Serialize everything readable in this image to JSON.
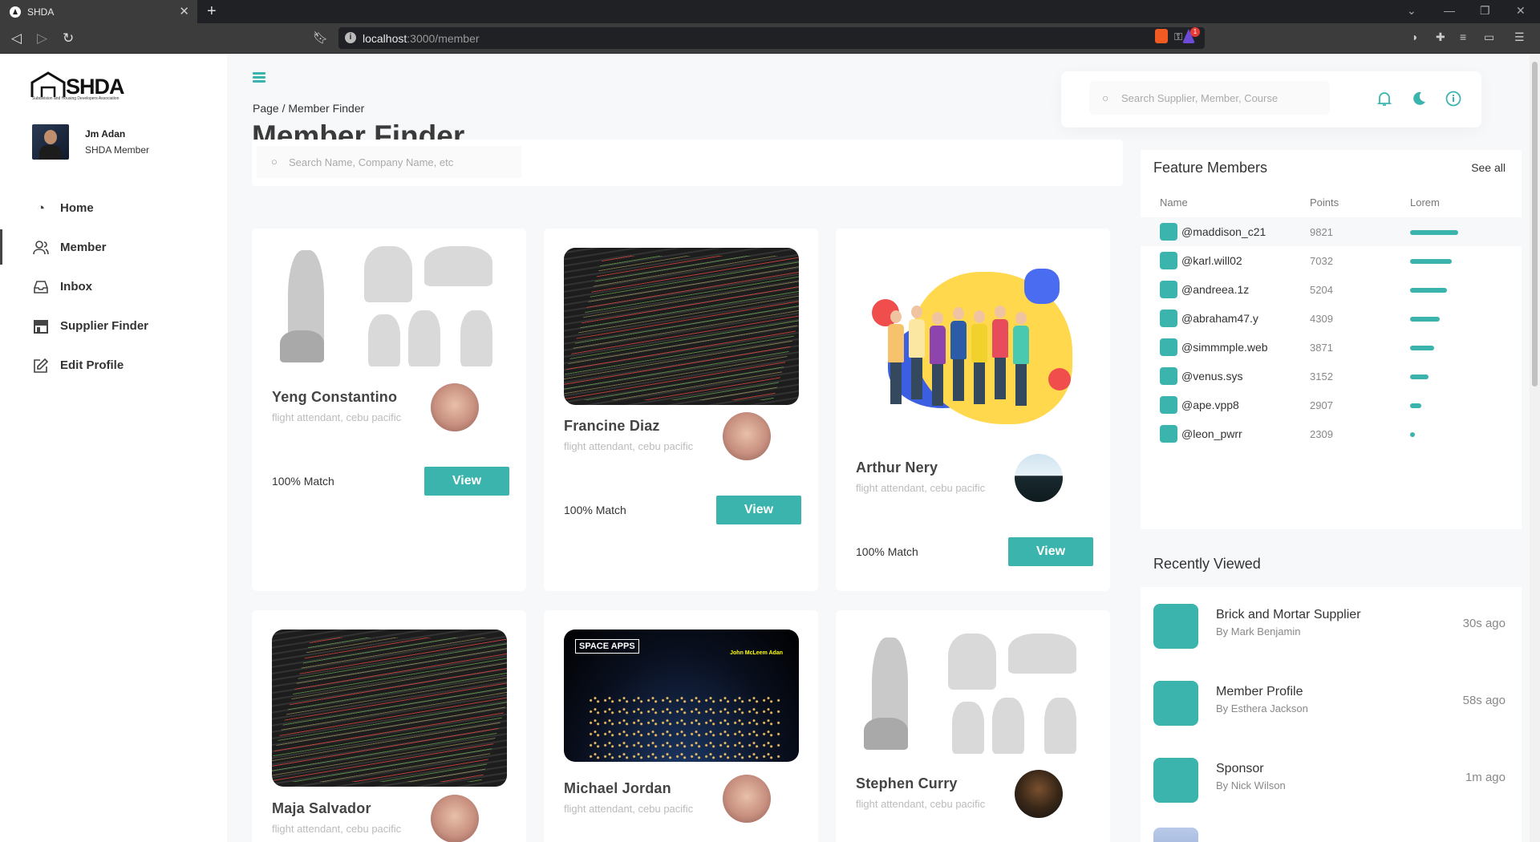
{
  "browser": {
    "tab_title": "SHDA",
    "url_host": "localhost",
    "url_path": ":3000/member",
    "notif_count": "1"
  },
  "brand": {
    "name": "SHDA",
    "tagline": "Subdivision and Housing Developers Association"
  },
  "user": {
    "name": "Jm Adan",
    "role": "SHDA Member"
  },
  "sidebar": {
    "items": [
      {
        "label": "Home",
        "icon": "gauge-icon"
      },
      {
        "label": "Member",
        "icon": "users-icon"
      },
      {
        "label": "Inbox",
        "icon": "inbox-icon"
      },
      {
        "label": "Supplier Finder",
        "icon": "store-icon"
      },
      {
        "label": "Edit Profile",
        "icon": "edit-icon"
      }
    ]
  },
  "header": {
    "breadcrumb": "Page / Member Finder",
    "title": "Member Finder",
    "search_placeholder": "Search Supplier, Member, Course"
  },
  "member_search": {
    "placeholder": "Search Name, Company Name, etc"
  },
  "cards": [
    {
      "name": "Yeng Constantino",
      "subtitle": "flight attendant, cebu pacific",
      "match": "100% Match",
      "button": "View",
      "image": "workout-illustration"
    },
    {
      "name": "Francine Diaz",
      "subtitle": "flight attendant, cebu pacific",
      "match": "100% Match",
      "button": "View",
      "image": "code-screen"
    },
    {
      "name": "Arthur Nery",
      "subtitle": "flight attendant, cebu pacific",
      "match": "100% Match",
      "button": "View",
      "image": "people-illustration"
    },
    {
      "name": "Maja Salvador",
      "subtitle": "flight attendant, cebu pacific",
      "image": "code-screen"
    },
    {
      "name": "Michael Jordan",
      "subtitle": "flight attendant, cebu pacific",
      "image": "space-apps",
      "image_text": "SPACE APPS",
      "image_person": "John McLeem Adan"
    },
    {
      "name": "Stephen Curry",
      "subtitle": "flight attendant, cebu pacific",
      "image": "workout-illustration"
    }
  ],
  "featured": {
    "title": "Feature Members",
    "see_all": "See all",
    "columns": [
      "Name",
      "Points",
      "Lorem"
    ],
    "rows": [
      {
        "handle": "@maddison_c21",
        "points": "9821",
        "level": 1.0
      },
      {
        "handle": "@karl.will02",
        "points": "7032",
        "level": 0.86
      },
      {
        "handle": "@andreea.1z",
        "points": "5204",
        "level": 0.76
      },
      {
        "handle": "@abraham47.y",
        "points": "4309",
        "level": 0.62
      },
      {
        "handle": "@simmmple.web",
        "points": "3871",
        "level": 0.5
      },
      {
        "handle": "@venus.sys",
        "points": "3152",
        "level": 0.38
      },
      {
        "handle": "@ape.vpp8",
        "points": "2907",
        "level": 0.24
      },
      {
        "handle": "@leon_pwrr",
        "points": "2309",
        "level": 0.1
      }
    ]
  },
  "recent": {
    "title": "Recently Viewed",
    "items": [
      {
        "title": "Brick and Mortar Supplier",
        "by": "By Mark Benjamin",
        "time": "30s ago"
      },
      {
        "title": "Member Profile",
        "by": "By Esthera Jackson",
        "time": "58s ago"
      },
      {
        "title": "Sponsor",
        "by": "By Nick Wilson",
        "time": "1m ago"
      }
    ]
  },
  "colors": {
    "accent": "#3bb4ae",
    "browser_dark": "#202124"
  }
}
